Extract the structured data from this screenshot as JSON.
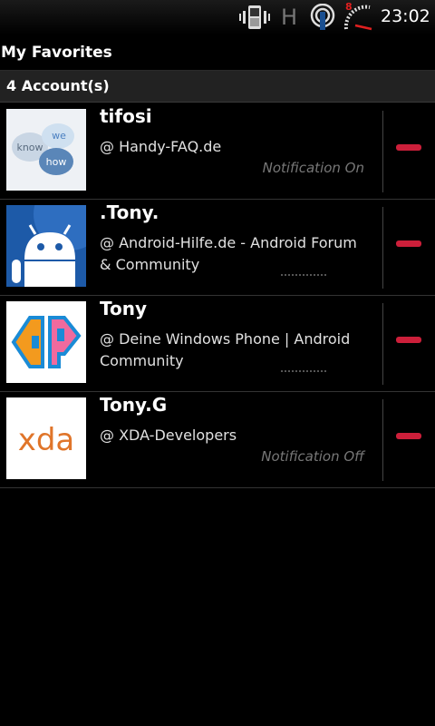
{
  "status_bar": {
    "network_type": "H",
    "battery_level": "8",
    "time": "23:02"
  },
  "header": {
    "title": "My Favorites",
    "account_count_label": "4 Account(s)"
  },
  "accounts": [
    {
      "name": "tifosi",
      "forum": "@ Handy-FAQ.de",
      "notification": "Notification On",
      "thumb_words": [
        "know",
        "we",
        "how"
      ]
    },
    {
      "name": ".Tony.",
      "forum": "@ Android-Hilfe.de - Android Forum & Community",
      "notification": ""
    },
    {
      "name": "Tony",
      "forum": "@ Deine Windows Phone | Android Community",
      "notification": ""
    },
    {
      "name": "Tony.G",
      "forum": "@ XDA-Developers",
      "notification": "Notification Off",
      "thumb_text": "xda"
    }
  ],
  "colors": {
    "remove_button": "#cc1f3a",
    "background": "#000000"
  }
}
